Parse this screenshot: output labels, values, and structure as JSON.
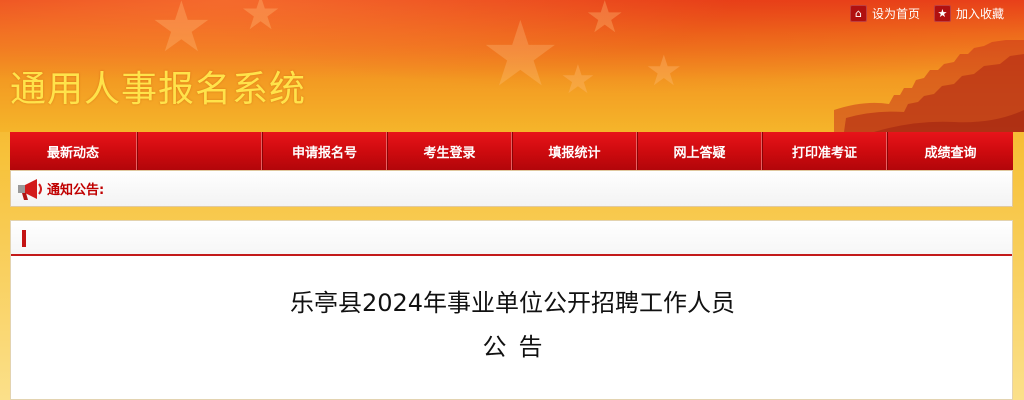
{
  "header": {
    "top_links": [
      {
        "label": "设为首页",
        "icon": "home-icon"
      },
      {
        "label": "加入收藏",
        "icon": "star-icon"
      }
    ],
    "site_title": "通用人事报名系统"
  },
  "nav": {
    "items": [
      {
        "label": "最新动态"
      },
      {
        "label": ""
      },
      {
        "label": "申请报名号"
      },
      {
        "label": "考生登录"
      },
      {
        "label": "填报统计"
      },
      {
        "label": "网上答疑"
      },
      {
        "label": "打印准考证"
      },
      {
        "label": "成绩查询"
      }
    ]
  },
  "notice": {
    "label": "通知公告:",
    "icon": "megaphone-icon"
  },
  "article": {
    "title": "乐亭县2024年事业单位公开招聘工作人员",
    "subtitle": "公告"
  },
  "colors": {
    "nav_red": "#cc0a0e",
    "title_yellow": "#ffe34a",
    "panel_accent": "#c31a1a"
  }
}
